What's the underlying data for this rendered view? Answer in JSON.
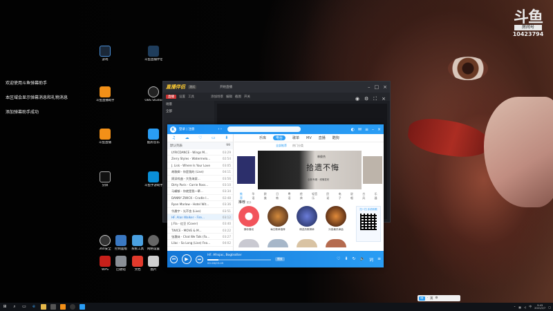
{
  "watermark": {
    "logo": "斗鱼",
    "tag": "房间号",
    "room": "10423794"
  },
  "notices": [
    "欢迎使用斗鱼弹幕助手",
    "本区域会显示弹幕消息和礼物消息",
    "添加弹幕助手成功"
  ],
  "desktop_icons": [
    {
      "label": "游戏"
    },
    {
      "label": "斗鱼直播伴侣"
    },
    {
      "label": "斗鱼直播助手"
    },
    {
      "label": "OBS Studio"
    },
    {
      "label": "斗鱼直播"
    },
    {
      "label": "酷狗音乐"
    },
    {
      "label": "分屏"
    },
    {
      "label": "斗鱼手游助手"
    },
    {
      "label": "360安全"
    },
    {
      "label": "控制面板"
    },
    {
      "label": "系统工具"
    },
    {
      "label": "网络设置"
    },
    {
      "label": "WPS"
    },
    {
      "label": "回收站"
    },
    {
      "label": "文档"
    },
    {
      "label": "图片"
    }
  ],
  "obs": {
    "app_title": "直播伴侣",
    "badge": "测试",
    "menu": "开始直播",
    "tabs": [
      "直播",
      "设置",
      "工具"
    ],
    "toolbar": [
      "添加场景",
      "编辑",
      "截图",
      "开关"
    ],
    "side_rows": [
      "场景",
      "全部"
    ],
    "icons": [
      "gear-icon",
      "close-icon"
    ]
  },
  "kugou": {
    "user": "登录 | 注册",
    "nav_tabs": [
      "乐库",
      "电台",
      "歌单",
      "MV",
      "直播",
      "酷狗"
    ],
    "active_tab": "电台",
    "subtabs": [
      "全部推荐",
      "热门分类"
    ],
    "active_subtab": "全部推荐",
    "banner": {
      "small": "林俊杰",
      "title": "拾遗不悔",
      "sub": "全新专辑 · 倾情发布"
    },
    "categories": [
      "推荐",
      "华语",
      "欧美",
      "日韩",
      "粤语",
      "经典",
      "轻音乐",
      "民谣",
      "电子",
      "说唱",
      "古风",
      "乐器"
    ],
    "active_category": "推荐",
    "recommend": {
      "title": "推荐",
      "sub": "更多"
    },
    "cards": [
      "猜你喜欢",
      "每日歌单推荐",
      "精选热歌榜单",
      "抖音最热单曲",
      "热门电音精选"
    ],
    "qr": "扫一扫 手机听歌",
    "list_header": {
      "title": "默认列表",
      "count": "99"
    },
    "songs": [
      {
        "name": "LYRICDANCE - Wings M...",
        "dur": "03:29"
      },
      {
        "name": "Zerry Styles - Watermelo...",
        "dur": "02:54"
      },
      {
        "name": "J. Lisk - Where Is Your Love",
        "dur": "03:05"
      },
      {
        "name": "胡歌卿 - 你是我的 (Live)",
        "dur": "04:11"
      },
      {
        "name": "周深戏曲 - 大鱼海棠...",
        "dur": "03:56"
      },
      {
        "name": "Dirty Paris - Carrie Ross...",
        "dur": "03:10"
      },
      {
        "name": "马頔郁 - 你就是我一辈...",
        "dur": "03:34"
      },
      {
        "name": "DANNY ZWICK - Cradle I...",
        "dur": "02:48"
      },
      {
        "name": "Ryan Marlow - Hotel Wit...",
        "dur": "03:36"
      },
      {
        "name": "华晨宇 - 光不舍 (Live)",
        "dur": "03:51"
      },
      {
        "name": "HF. Alan Walker - Fire...",
        "dur": "03:12"
      },
      {
        "name": "J.Fla - 红豆 (Cover)",
        "dur": "03:40"
      },
      {
        "name": "TWICE - MOVE & M...",
        "dur": "03:22"
      },
      {
        "name": "张惠妹 - Chat We Talk (Fa...",
        "dur": "03:27"
      },
      {
        "name": "Lilac - So Long (Live) Fea...",
        "dur": "04:02"
      }
    ],
    "active_song_index": 10,
    "now_playing": {
      "title": "HF. Afrojac, Bogtrotter",
      "time": "00:28/03:49",
      "progress": 0.17
    },
    "mode_label": "播放",
    "colors": {
      "accent": "#2a9df4",
      "footer": "#1477d6"
    }
  },
  "taskbar": {
    "icons": [
      "windows-icon",
      "search-icon",
      "task-view-icon",
      "edge-icon",
      "folder-icon",
      "store-icon",
      "douyu-icon",
      "obs-icon",
      "kugou-icon"
    ],
    "tray_text": "中",
    "clock_time": "9:43",
    "clock_date": "2021/2/7",
    "ime": [
      "中",
      "·",
      "英",
      "⚙"
    ]
  }
}
